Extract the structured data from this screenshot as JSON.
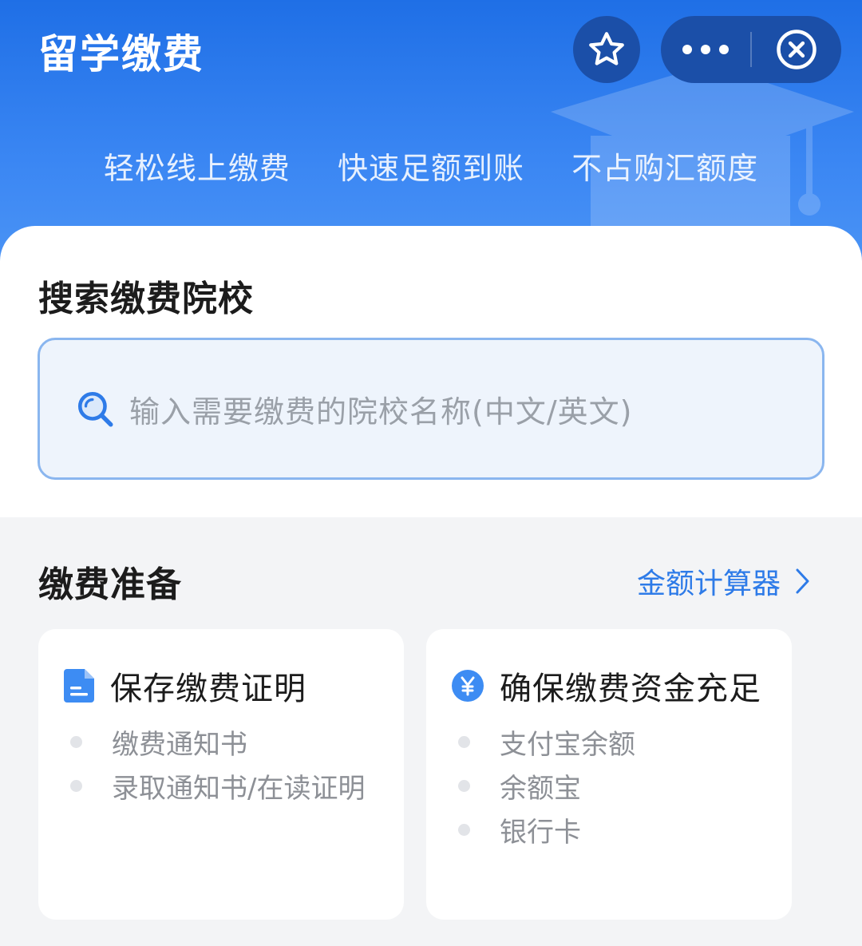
{
  "header": {
    "title": "留学缴费",
    "taglines": [
      "轻松线上缴费",
      "快速足额到账",
      "不占购汇额度"
    ],
    "favorite_icon": "star-icon",
    "more_icon": "more-dots-icon",
    "close_icon": "close-circle-icon"
  },
  "search": {
    "title": "搜索缴费院校",
    "placeholder": "输入需要缴费的院校名称(中文/英文)",
    "icon": "search-icon"
  },
  "prep": {
    "title": "缴费准备",
    "calculator_link": "金额计算器",
    "cards": [
      {
        "icon": "document-icon",
        "title": "保存缴费证明",
        "items": [
          "缴费通知书",
          "录取通知书/在读证明"
        ]
      },
      {
        "icon": "yuan-icon",
        "title": "确保缴费资金充足",
        "items": [
          "支付宝余额",
          "余额宝",
          "银行卡"
        ]
      }
    ]
  },
  "colors": {
    "header_blue": "#1f6fe6",
    "accent_blue": "#2e7be8",
    "search_border": "#8ab6ef"
  }
}
